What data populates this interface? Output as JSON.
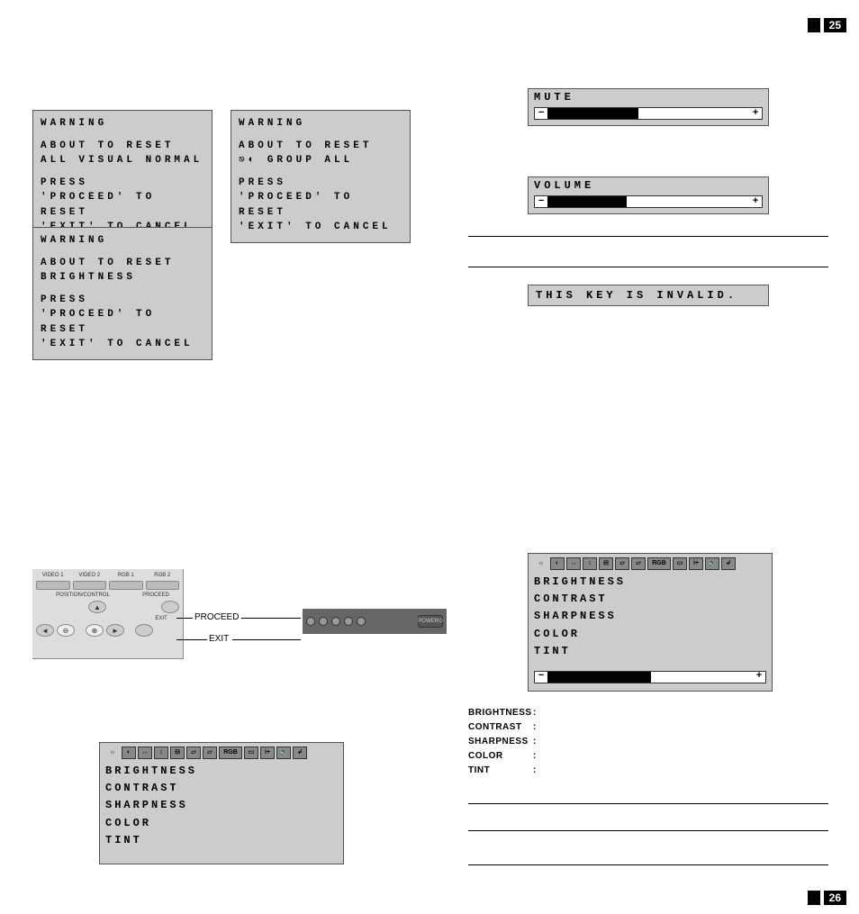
{
  "pages": {
    "top": "25",
    "bottom": "26"
  },
  "warnings": {
    "w1": {
      "title": "WARNING",
      "l1": "ABOUT TO RESET",
      "l2": "ALL VISUAL NORMAL",
      "l3": "PRESS",
      "l4": "'PROCEED' TO RESET",
      "l5": "'EXIT' TO CANCEL"
    },
    "w2": {
      "title": "WARNING",
      "l1": "ABOUT TO RESET",
      "l2": "⎋◐ GROUP ALL",
      "l3": "PRESS",
      "l4": "'PROCEED' TO RESET",
      "l5": "'EXIT' TO CANCEL"
    },
    "w3": {
      "title": "WARNING",
      "l1": "ABOUT TO RESET",
      "l2": "BRIGHTNESS",
      "l3": "PRESS",
      "l4": "'PROCEED' TO RESET",
      "l5": "'EXIT' TO CANCEL"
    }
  },
  "mute": {
    "label": "MUTE",
    "fill_pct": 40
  },
  "volume": {
    "label": "VOLUME",
    "fill_pct": 35
  },
  "invalid": {
    "text": "THIS KEY IS INVALID."
  },
  "remote": {
    "src_labels": [
      "VIDEO 1",
      "VIDEO 2",
      "RGB 1",
      "RGB 2"
    ],
    "posctrl": "POSITION/CONTROL",
    "proceed": "PROCEED",
    "exit": "EXIT",
    "power": "POWER"
  },
  "callouts": {
    "proceed": "PROCEED",
    "exit": "EXIT"
  },
  "menu": {
    "items": [
      "BRIGHTNESS",
      "CONTRAST",
      "SHARPNESS",
      "COLOR",
      "TINT"
    ],
    "icons_rgb": "RGB"
  },
  "menu2": {
    "items": [
      "BRIGHTNESS",
      "CONTRAST",
      "SHARPNESS",
      "COLOR",
      "TINT"
    ],
    "fill_pct": 45
  },
  "defs": {
    "items": [
      {
        "label": "BRIGHTNESS",
        "sep": ":"
      },
      {
        "label": "CONTRAST",
        "sep": ":"
      },
      {
        "label": "SHARPNESS",
        "sep": ":"
      },
      {
        "label": "COLOR",
        "sep": ":"
      },
      {
        "label": "TINT",
        "sep": ":"
      }
    ]
  }
}
